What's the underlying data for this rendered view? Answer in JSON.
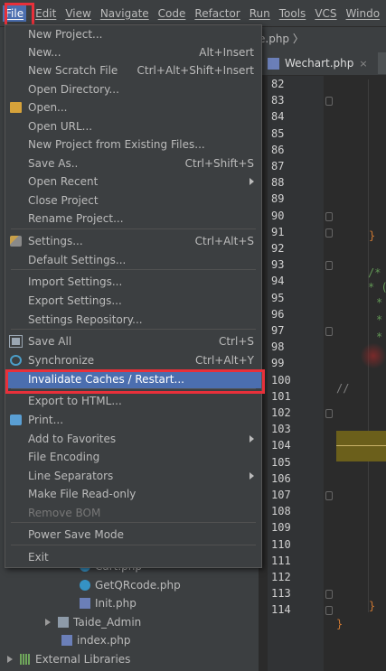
{
  "menubar": {
    "items": [
      "File",
      "Edit",
      "View",
      "Navigate",
      "Code",
      "Refactor",
      "Run",
      "Tools",
      "VCS",
      "Windo"
    ]
  },
  "breadcrumb": {
    "file": "e.php",
    "sep": "〉"
  },
  "tab": {
    "label": "Wechart.php",
    "close": "×"
  },
  "project_tree": [
    {
      "label": "Cart.php",
      "icon": "c-class-icon"
    },
    {
      "label": "GetQRcode.php",
      "icon": "c-class-icon"
    },
    {
      "label": "Init.php",
      "icon": "php-file-icon"
    },
    {
      "label": "Taide_Admin",
      "icon": "folder-icon"
    },
    {
      "label": "index.php",
      "icon": "php-file-icon"
    },
    {
      "label": "External Libraries",
      "icon": "libraries-icon"
    }
  ],
  "file_menu": {
    "items": [
      {
        "label": "New Project...",
        "shortcut": ""
      },
      {
        "label": "New...",
        "shortcut": "Alt+Insert"
      },
      {
        "label": "New Scratch File",
        "shortcut": "Ctrl+Alt+Shift+Insert"
      },
      {
        "label": "Open Directory...",
        "shortcut": ""
      },
      {
        "label": "Open...",
        "shortcut": "",
        "icon": "open-folder-icon"
      },
      {
        "label": "Open URL...",
        "shortcut": ""
      },
      {
        "label": "New Project from Existing Files...",
        "shortcut": ""
      },
      {
        "label": "Save As..",
        "shortcut": "Ctrl+Shift+S"
      },
      {
        "label": "Open Recent",
        "shortcut": "",
        "submenu": true
      },
      {
        "label": "Close Project",
        "shortcut": ""
      },
      {
        "label": "Rename Project...",
        "shortcut": ""
      },
      {
        "label": "Settings...",
        "shortcut": "Ctrl+Alt+S",
        "icon": "settings-wrench-icon"
      },
      {
        "label": "Default Settings...",
        "shortcut": ""
      },
      {
        "label": "Import Settings...",
        "shortcut": ""
      },
      {
        "label": "Export Settings...",
        "shortcut": ""
      },
      {
        "label": "Settings Repository...",
        "shortcut": ""
      },
      {
        "label": "Save All",
        "shortcut": "Ctrl+S",
        "icon": "save-all-icon"
      },
      {
        "label": "Synchronize",
        "shortcut": "Ctrl+Alt+Y",
        "icon": "synchronize-icon"
      },
      {
        "label": "Invalidate Caches / Restart...",
        "shortcut": "",
        "selected": true
      },
      {
        "label": "Export to HTML...",
        "shortcut": ""
      },
      {
        "label": "Print...",
        "shortcut": "",
        "icon": "print-icon"
      },
      {
        "label": "Add to Favorites",
        "shortcut": "",
        "submenu": true
      },
      {
        "label": "File Encoding",
        "shortcut": ""
      },
      {
        "label": "Line Separators",
        "shortcut": "",
        "submenu": true
      },
      {
        "label": "Make File Read-only",
        "shortcut": ""
      },
      {
        "label": "Remove BOM",
        "shortcut": "",
        "disabled": true
      },
      {
        "label": "Power Save Mode",
        "shortcut": ""
      },
      {
        "label": "Exit",
        "shortcut": ""
      }
    ]
  },
  "editor": {
    "line_numbers": [
      "82",
      "83",
      "84",
      "85",
      "86",
      "87",
      "88",
      "89",
      "90",
      "91",
      "92",
      "93",
      "94",
      "95",
      "96",
      "97",
      "98",
      "99",
      "100",
      "101",
      "102",
      "103",
      "104",
      "105",
      "106",
      "107",
      "108",
      "109",
      "110",
      "111",
      "112",
      "113",
      "114"
    ],
    "code_fragments": {
      "brace_91": "}",
      "comment_93": "/*",
      "comment_94": "* (",
      "comment_95": "*",
      "comment_96": "*",
      "comment_97": "*",
      "comment_100": "//",
      "brace_113": "}",
      "brace_114": "}"
    }
  },
  "colors": {
    "selection": "#4b6eaf",
    "highlight_box": "#e8303a",
    "menu_bg": "#3c3f41",
    "editor_bg": "#2b2b2b"
  }
}
